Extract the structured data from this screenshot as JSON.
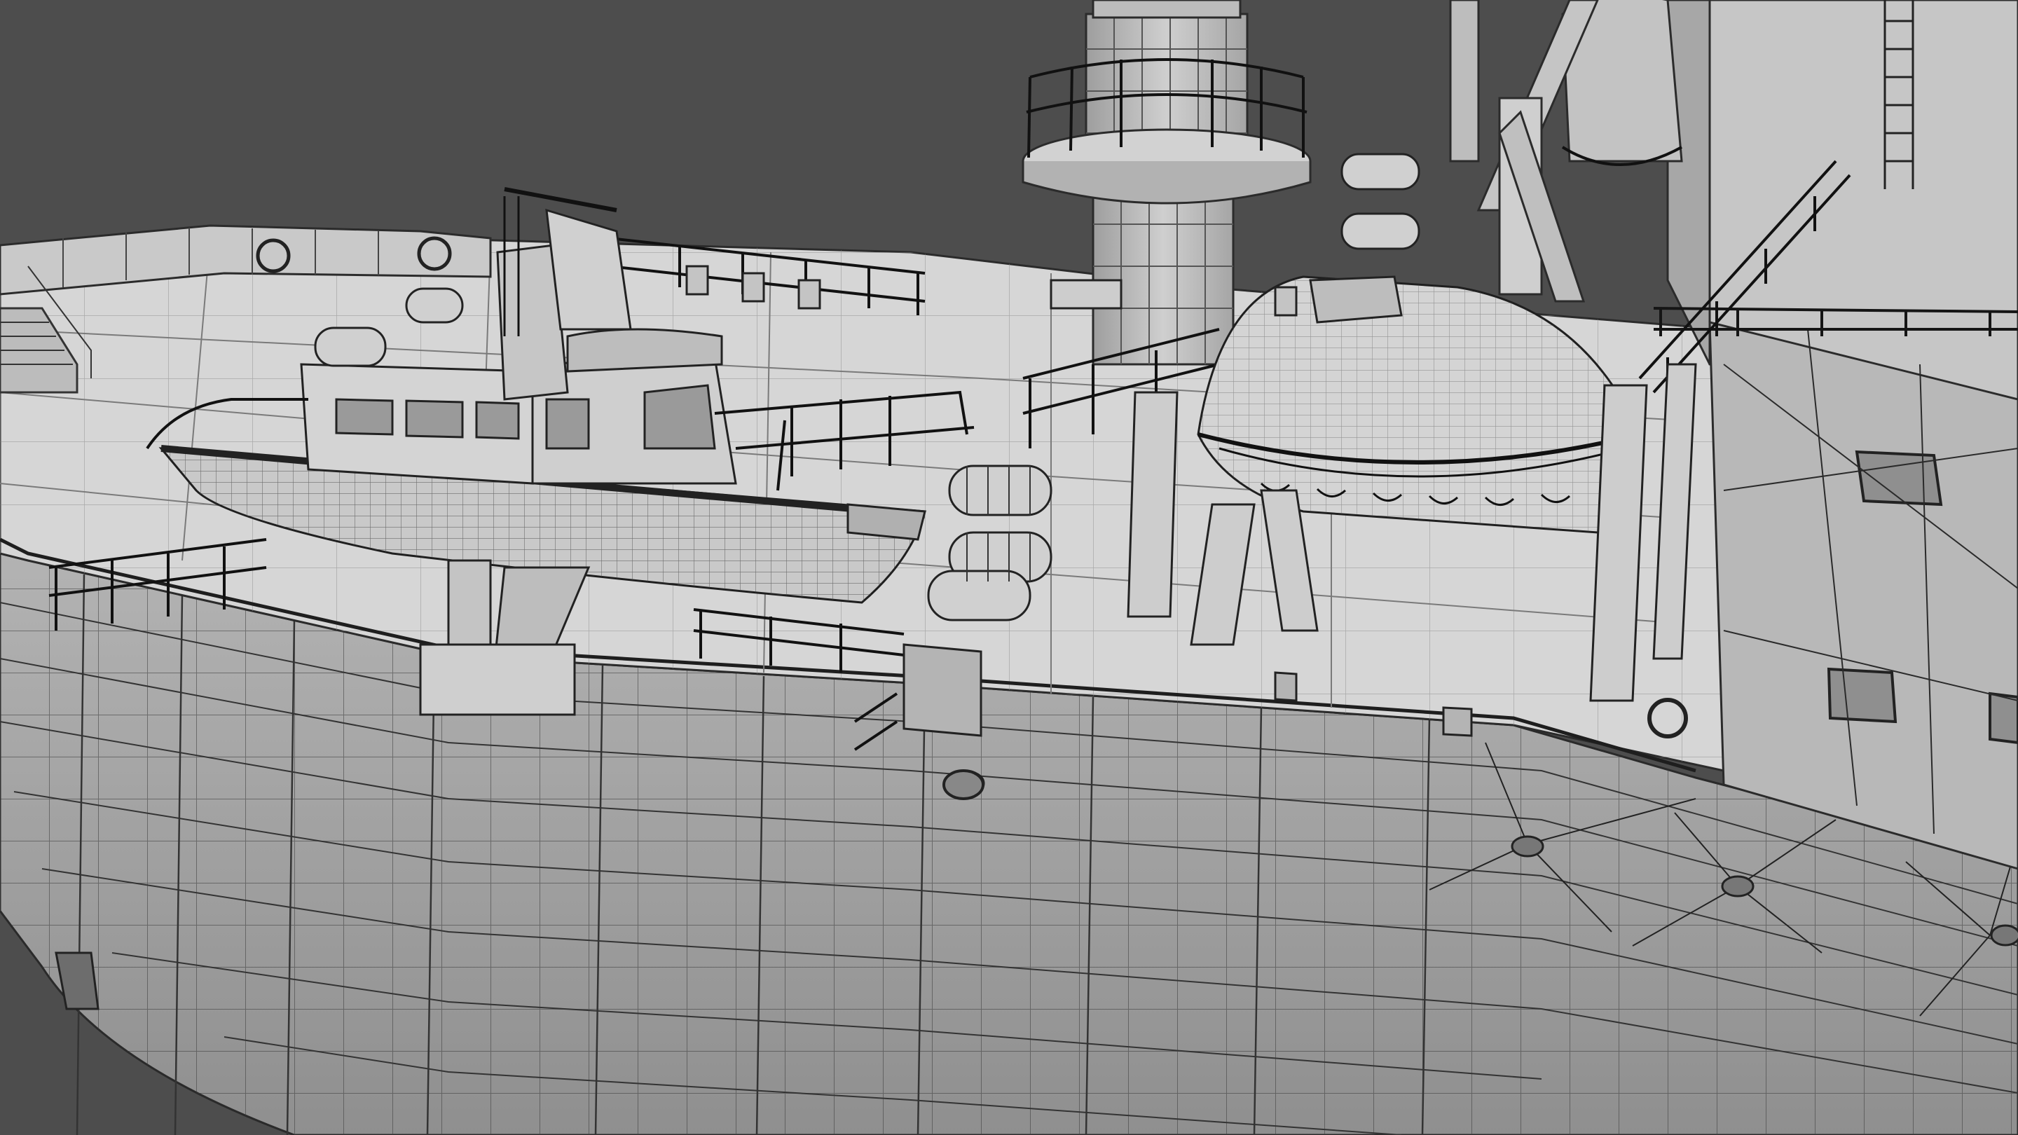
{
  "viewport": {
    "mode": "wireframe-on-shaded",
    "subject": "ship-deck",
    "colors": {
      "background": "#4d4d4d",
      "hull": "#a9a9a9",
      "deck": "#d9d9d9",
      "structure": "#c8c8c8",
      "wire": "#2a2a2a",
      "rail": "#1a1a1a"
    }
  }
}
